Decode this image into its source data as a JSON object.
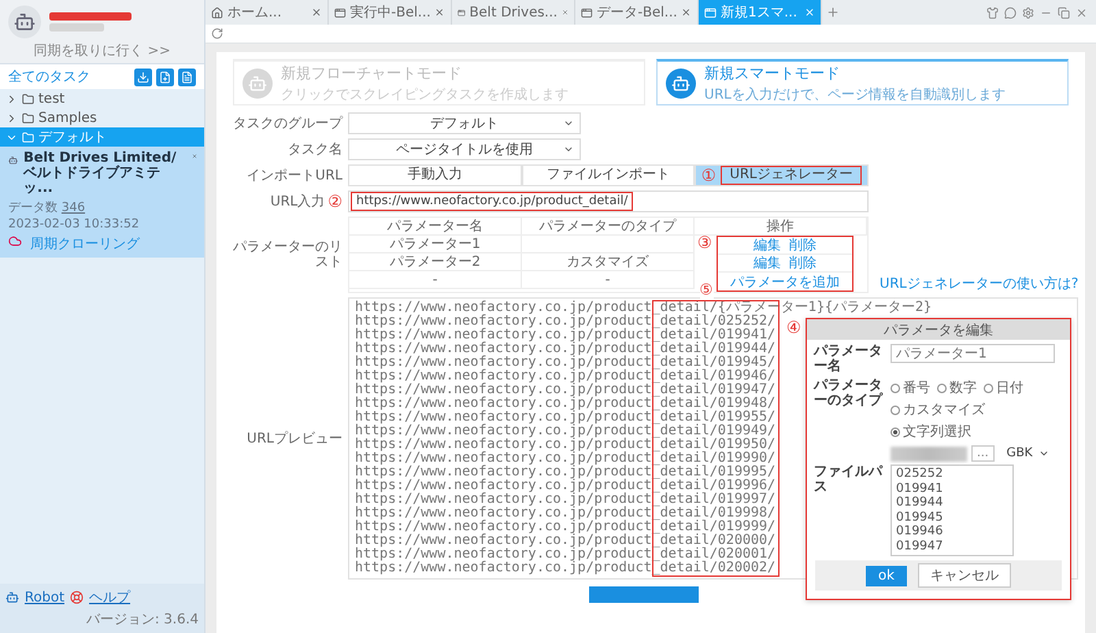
{
  "tabs": [
    {
      "label": "ホーム...",
      "kind": "home",
      "selected": false
    },
    {
      "label": "実行中-Bel...",
      "kind": "page",
      "selected": false
    },
    {
      "label": "Belt Drives...",
      "kind": "page",
      "selected": false
    },
    {
      "label": "データ-Bel...",
      "kind": "page",
      "selected": false
    },
    {
      "label": "新規1スマ...",
      "kind": "page",
      "selected": true
    }
  ],
  "sidebar": {
    "invite_link": "同期を取りに行く >>",
    "header": "全てのタスク",
    "tree": [
      {
        "label": "test",
        "expanded": false,
        "selected": false
      },
      {
        "label": "Samples",
        "expanded": false,
        "selected": false
      },
      {
        "label": "デフォルト",
        "expanded": true,
        "selected": true,
        "children": [
          {
            "title": "Belt Drives Limited/ベルトドライブアミテッ...",
            "count_label": "データ数",
            "count": "346",
            "time": "2023-02-03 10:33:52",
            "action": "周期クローリング"
          }
        ]
      }
    ],
    "footer": {
      "links": [
        "Robot",
        "ヘルプ"
      ],
      "version": "バージョン: 3.6.4"
    }
  },
  "modes": [
    {
      "title": "新規フローチャートモード",
      "description": "クリックでスクレイピングタスクを作成します",
      "selected": false
    },
    {
      "title": "新規スマートモード",
      "description": "URLを入力だけで、ページ情報を自動識別します",
      "selected": true
    }
  ],
  "form": {
    "group": {
      "label": "タスクのグループ",
      "value": "デフォルト"
    },
    "name": {
      "label": "タスク名",
      "value": "ページタイトルを使用"
    },
    "import_url": {
      "label": "インポートURL",
      "options": [
        {
          "label": "手動入力",
          "selected": false
        },
        {
          "label": "ファイルインポート",
          "selected": false
        },
        {
          "label": "URLジェネレーター",
          "selected": true,
          "callout": "①"
        }
      ]
    },
    "url_input": {
      "label": "URL入力",
      "value": "https://www.neofactory.co.jp/product_detail/",
      "callout": "②"
    },
    "param_list": {
      "label": "パラメーターのリスト",
      "columns": [
        "パラメーター名",
        "パラメーターのタイプ",
        "操作"
      ],
      "callout": "③",
      "rows": [
        {
          "name": "パラメーター1",
          "actions": [
            "編集",
            "削除"
          ]
        },
        {
          "name": "パラメーター2",
          "type": "カスタマイズ",
          "actions": [
            "編集",
            "削除"
          ]
        }
      ],
      "add_row": {
        "name": "-",
        "type": "-",
        "action": "パラメータを追加"
      },
      "help_link": "URLジェネレーターの使い方は?"
    },
    "preview": {
      "label": "URLプレビュー",
      "callout": "⑤",
      "lines": [
        "https://www.neofactory.co.jp/product_detail/{パラメーター1}{パラメーター2}",
        "https://www.neofactory.co.jp/product_detail/025252/",
        "https://www.neofactory.co.jp/product_detail/019941/",
        "https://www.neofactory.co.jp/product_detail/019944/",
        "https://www.neofactory.co.jp/product_detail/019945/",
        "https://www.neofactory.co.jp/product_detail/019946/",
        "https://www.neofactory.co.jp/product_detail/019947/",
        "https://www.neofactory.co.jp/product_detail/019948/",
        "https://www.neofactory.co.jp/product_detail/019955/",
        "https://www.neofactory.co.jp/product_detail/019949/",
        "https://www.neofactory.co.jp/product_detail/019950/",
        "https://www.neofactory.co.jp/product_detail/019990/",
        "https://www.neofactory.co.jp/product_detail/019995/",
        "https://www.neofactory.co.jp/product_detail/019996/",
        "https://www.neofactory.co.jp/product_detail/019997/",
        "https://www.neofactory.co.jp/product_detail/019998/",
        "https://www.neofactory.co.jp/product_detail/019999/",
        "https://www.neofactory.co.jp/product_detail/020000/",
        "https://www.neofactory.co.jp/product_detail/020001/",
        "https://www.neofactory.co.jp/product_detail/020002/"
      ]
    }
  },
  "dialog": {
    "title": "パラメータを編集",
    "callout": "④",
    "name_label": "パラメーター名",
    "name_value": "パラメーター1",
    "type_label": "パラメーターのタイプ",
    "types": [
      {
        "label": "番号",
        "selected": false
      },
      {
        "label": "数字",
        "selected": false
      },
      {
        "label": "日付",
        "selected": false
      },
      {
        "label": "カスタマイズ",
        "selected": false
      },
      {
        "label": "文字列選択",
        "selected": true
      }
    ],
    "path_label": "ファイルパス",
    "browse": "...",
    "encoding": "GBK",
    "values": [
      "025252",
      "019941",
      "019944",
      "019945",
      "019946",
      "019947"
    ],
    "buttons": [
      {
        "label": "ok",
        "kind": "primary"
      },
      {
        "label": "キャンセル",
        "kind": "secondary"
      }
    ]
  }
}
